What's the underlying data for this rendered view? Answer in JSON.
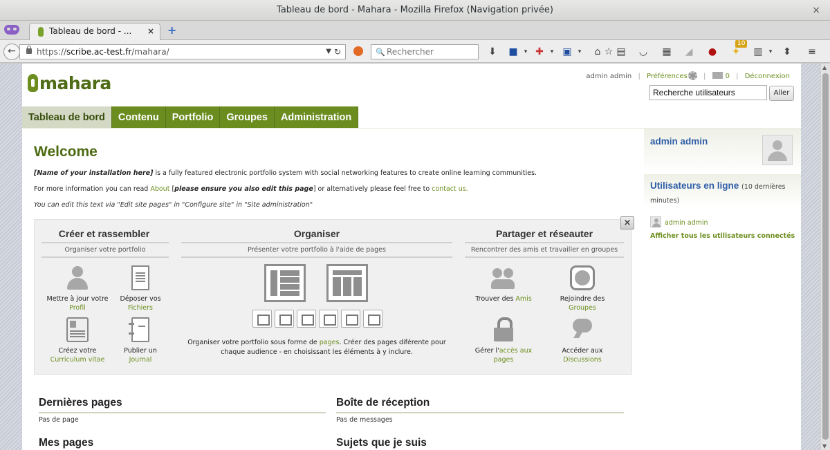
{
  "window": {
    "title": "Tableau de bord - Mahara - Mozilla Firefox (Navigation privée)",
    "close": "×"
  },
  "tab": {
    "title": "Tableau de bord - ...",
    "close": "×",
    "new_tab": "+"
  },
  "nav": {
    "url_scheme": "https://",
    "url_host": "scribe.ac-test.fr",
    "url_path": "/mahara/",
    "search_placeholder": "Rechercher",
    "addon_badge": "10"
  },
  "site": {
    "logo_text": "mahara",
    "user_link": "admin admin",
    "preferences": "Préférences",
    "inbox_count": "0",
    "logout": "Déconnexion",
    "user_search_value": "Recherche utilisateurs",
    "go_button": "Aller"
  },
  "menu": [
    {
      "label": "Tableau de bord",
      "active": true
    },
    {
      "label": "Contenu"
    },
    {
      "label": "Portfolio"
    },
    {
      "label": "Groupes"
    },
    {
      "label": "Administration"
    }
  ],
  "welcome": {
    "title": "Welcome",
    "p1_name": "[Name of your installation here]",
    "p1_rest": " is a fully featured electronic portfolio system with social networking features to create online learning communities.",
    "p2_a": "For more information you can read ",
    "p2_about": "About",
    "p2_b": " [",
    "p2_bold": "please ensure you also edit this page",
    "p2_c": "] or alternatively please feel free to ",
    "p2_contact": "contact us.",
    "p3": "You can edit this text via \"Edit site pages\" in \"Configure site\" in \"Site administration\""
  },
  "overview": {
    "close": "×",
    "col1": {
      "title": "Créer et rassembler",
      "subtitle": "Organiser votre portfolio",
      "tiles": [
        {
          "text": "Mettre à jour votre",
          "link": "Profil",
          "icon": "person-icon"
        },
        {
          "text": "Déposer vos",
          "link": "Fichiers",
          "icon": "document-upload-icon"
        },
        {
          "text": "Créez votre",
          "link": "Curriculum vitae",
          "icon": "cv-icon"
        },
        {
          "text": "Publier un",
          "link": "Journal",
          "icon": "journal-icon"
        }
      ]
    },
    "col2": {
      "title": "Organiser",
      "subtitle": "Présenter votre portfolio à l'aide de pages",
      "text_a": "Organiser votre portfolio sous forme de ",
      "text_link": "pages",
      "text_b": ". Créer des pages diférente pour chaque audience - en choisissant les éléments à y inclure."
    },
    "col3": {
      "title": "Partager et réseauter",
      "subtitle": "Rencontrer des amis et travailler en groupes",
      "tiles": [
        {
          "text": "Trouver des ",
          "link": "Amis",
          "icon": "friends-icon"
        },
        {
          "text": "Rejoindre des",
          "link": "Groupes",
          "icon": "groups-icon"
        },
        {
          "text": "Gérer l'",
          "link": "accès aux pages",
          "icon": "lock-icon"
        },
        {
          "text": "Accéder aux",
          "link": "Discussions",
          "icon": "chat-icon"
        }
      ]
    }
  },
  "blocks": {
    "recent_pages": {
      "title": "Dernières pages",
      "empty": "Pas de page"
    },
    "inbox": {
      "title": "Boîte de réception",
      "empty": "Pas de messages"
    },
    "my_pages": {
      "title": "Mes pages"
    },
    "topics": {
      "title": "Sujets que je suis"
    }
  },
  "sidebar": {
    "profile_name": "admin admin",
    "online_title": "Utilisateurs en ligne",
    "online_note": "(10 dernières minutes)",
    "online_user": "admin admin",
    "show_all": "Afficher tous les utilisateurs connectés"
  }
}
